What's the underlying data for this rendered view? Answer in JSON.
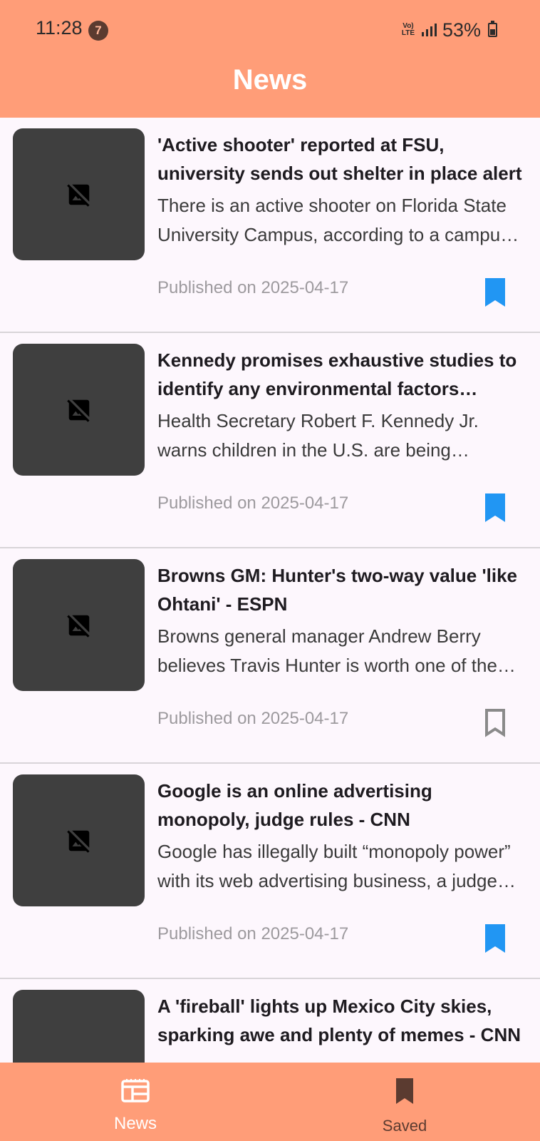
{
  "status_bar": {
    "time": "11:28",
    "notification_count": "7",
    "network": "VoLTE",
    "battery": "53%"
  },
  "app_bar": {
    "title": "News"
  },
  "articles": [
    {
      "title": "'Active shooter' reported at FSU, university sends out shelter in place alert",
      "description": "There is an active shooter on Florida State University Campus, according to a campus alert.",
      "date": "Published on 2025-04-17",
      "saved": true
    },
    {
      "title": "Kennedy promises exhaustive studies to identify any environmental factors behind autism",
      "description": "Health Secretary Robert F. Kennedy Jr. warns children in the U.S. are being diagnosed with autism.",
      "date": "Published on 2025-04-17",
      "saved": true
    },
    {
      "title": "Browns GM: Hunter's two-way value 'like Ohtani' - ESPN",
      "description": "Browns general manager Andrew Berry believes Travis Hunter is worth one of the top picks.",
      "date": "Published on 2025-04-17",
      "saved": false
    },
    {
      "title": "Google is an online advertising monopoly, judge rules - CNN",
      "description": "Google has illegally built “monopoly power” with its web advertising business, a judge ruled.",
      "date": "Published on 2025-04-17",
      "saved": true
    },
    {
      "title": "A 'fireball' lights up Mexico City skies, sparking awe and plenty of memes - CNN",
      "description": "",
      "date": "",
      "saved": false
    }
  ],
  "bottom_nav": {
    "items": [
      {
        "label": "News",
        "icon": "newspaper-icon",
        "active": true
      },
      {
        "label": "Saved",
        "icon": "bookmark-icon",
        "active": false
      }
    ]
  },
  "colors": {
    "primary": "#ff9d78",
    "bookmark_active": "#2196f3",
    "bookmark_inactive": "#8a8a8a",
    "thumbnail_bg": "#3f3f3f"
  }
}
